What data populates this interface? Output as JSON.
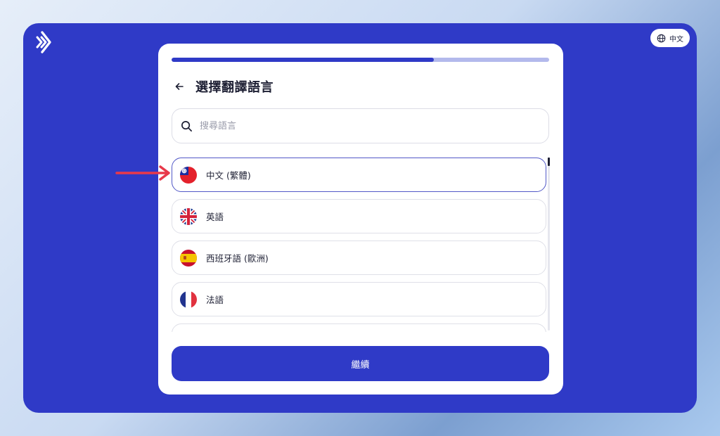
{
  "app": {
    "language_pill": {
      "label": "中文",
      "icon": "globe-icon"
    },
    "logo_icon": "double-chevron-logo-icon"
  },
  "colors": {
    "primary": "#2f3ac7",
    "progress_track": "#b3b9ec",
    "annotation_arrow": "#e8394a"
  },
  "card": {
    "progress": 0.695,
    "title": "選擇翻譯語言",
    "back_icon": "arrow-left-icon",
    "search": {
      "placeholder": "搜尋語言",
      "value": "",
      "icon": "search-icon"
    },
    "languages": [
      {
        "label": "中文 (繁體)",
        "flag": "taiwan-flag-icon",
        "selected": true
      },
      {
        "label": "英語",
        "flag": "uk-flag-icon",
        "selected": false
      },
      {
        "label": "西班牙語 (歐洲)",
        "flag": "spain-flag-icon",
        "selected": false
      },
      {
        "label": "法語",
        "flag": "france-flag-icon",
        "selected": false
      },
      {
        "label": "",
        "flag": "",
        "selected": false
      }
    ],
    "continue_label": "繼續"
  }
}
